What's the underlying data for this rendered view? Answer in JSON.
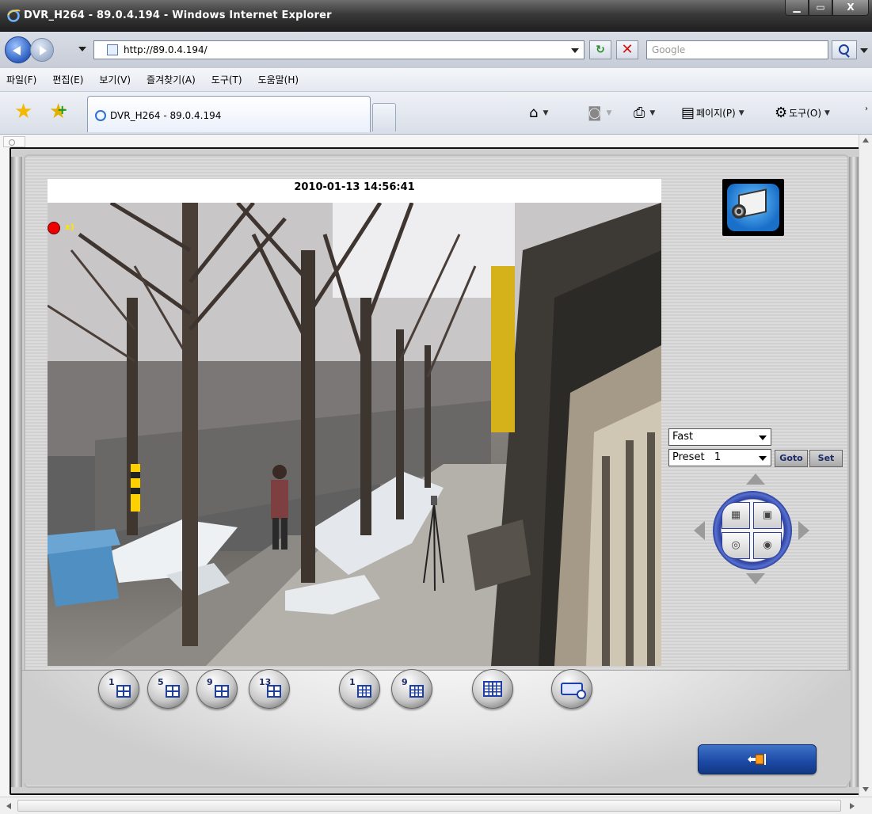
{
  "window": {
    "title": "DVR_H264 - 89.0.4.194 - Windows Internet Explorer",
    "buttons": [
      "minimize-icon",
      "maximize-icon",
      "close-icon"
    ]
  },
  "address_bar": {
    "url": "http://89.0.4.194/",
    "search_placeholder": "Google"
  },
  "menu": {
    "items": [
      "파일(F)",
      "편집(E)",
      "보기(V)",
      "즐겨찾기(A)",
      "도구(T)",
      "도움말(H)"
    ]
  },
  "tabs": {
    "active_label": "DVR_H264 - 89.0.4.194"
  },
  "command_bar": {
    "page_label": "페이지(P)",
    "tools_label": "도구(O)"
  },
  "dvr": {
    "timestamp": "2010-01-13 14:56:41",
    "speed": {
      "selected": "Fast"
    },
    "preset": {
      "selected": "Preset   1"
    },
    "goto_label": "Goto",
    "set_label": "Set",
    "layout_buttons": [
      {
        "num": "1",
        "icon": "quad-grid-icon"
      },
      {
        "num": "5",
        "icon": "quad-grid-icon"
      },
      {
        "num": "9",
        "icon": "quad-grid-icon"
      },
      {
        "num": "13",
        "icon": "quad-grid-icon"
      },
      {
        "num": "1",
        "icon": "nine-grid-icon"
      },
      {
        "num": "9",
        "icon": "nine-grid-icon"
      },
      {
        "num": "",
        "icon": "sixteen-grid-icon"
      },
      {
        "num": "",
        "icon": "search-camera-icon"
      }
    ]
  },
  "colors": {
    "title_bar": "#2b2b2b",
    "accent_blue": "#1d3fa6",
    "record_red": "#ee0000"
  }
}
